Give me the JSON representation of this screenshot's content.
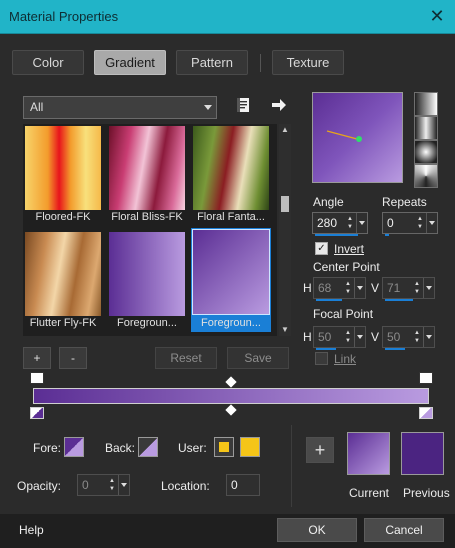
{
  "window": {
    "title": "Material Properties",
    "close_glyph": "✕"
  },
  "tabs": [
    {
      "label": "Color",
      "active": false
    },
    {
      "label": "Gradient",
      "active": true
    },
    {
      "label": "Pattern",
      "active": false
    },
    {
      "label": "Texture",
      "active": false
    }
  ],
  "category_select": {
    "value": "All"
  },
  "gradients": [
    {
      "label": "Floored-FK"
    },
    {
      "label": "Floral Bliss-FK"
    },
    {
      "label": "Floral Fanta..."
    },
    {
      "label": "Flutter Fly-FK"
    },
    {
      "label": "Foregroun..."
    },
    {
      "label": "Foregroun...",
      "selected": true
    }
  ],
  "gallery_buttons": {
    "add": "+",
    "remove": "-",
    "reset": "Reset",
    "save": "Save"
  },
  "angle": {
    "label": "Angle",
    "value": "280"
  },
  "repeats": {
    "label": "Repeats",
    "value": "0"
  },
  "invert": {
    "label": "Invert",
    "checked": true
  },
  "center_point": {
    "label": "Center Point",
    "h_label": "H",
    "h_value": "68",
    "v_label": "V",
    "v_value": "71"
  },
  "focal_point": {
    "label": "Focal Point",
    "h_label": "H",
    "h_value": "50",
    "v_label": "V",
    "v_value": "50"
  },
  "link": {
    "label": "Link",
    "checked": false
  },
  "colors": {
    "start": "#5b2e94",
    "end": "#b99be0",
    "user": "#f5c518"
  },
  "stop_controls": {
    "fore_label": "Fore:",
    "back_label": "Back:",
    "user_label": "User:",
    "opacity_label": "Opacity:",
    "opacity_value": "0",
    "location_label": "Location:",
    "location_value": "0"
  },
  "swatches": {
    "add": "+",
    "current_label": "Current",
    "previous_label": "Previous"
  },
  "footer": {
    "help": "Help",
    "ok": "OK",
    "cancel": "Cancel"
  }
}
